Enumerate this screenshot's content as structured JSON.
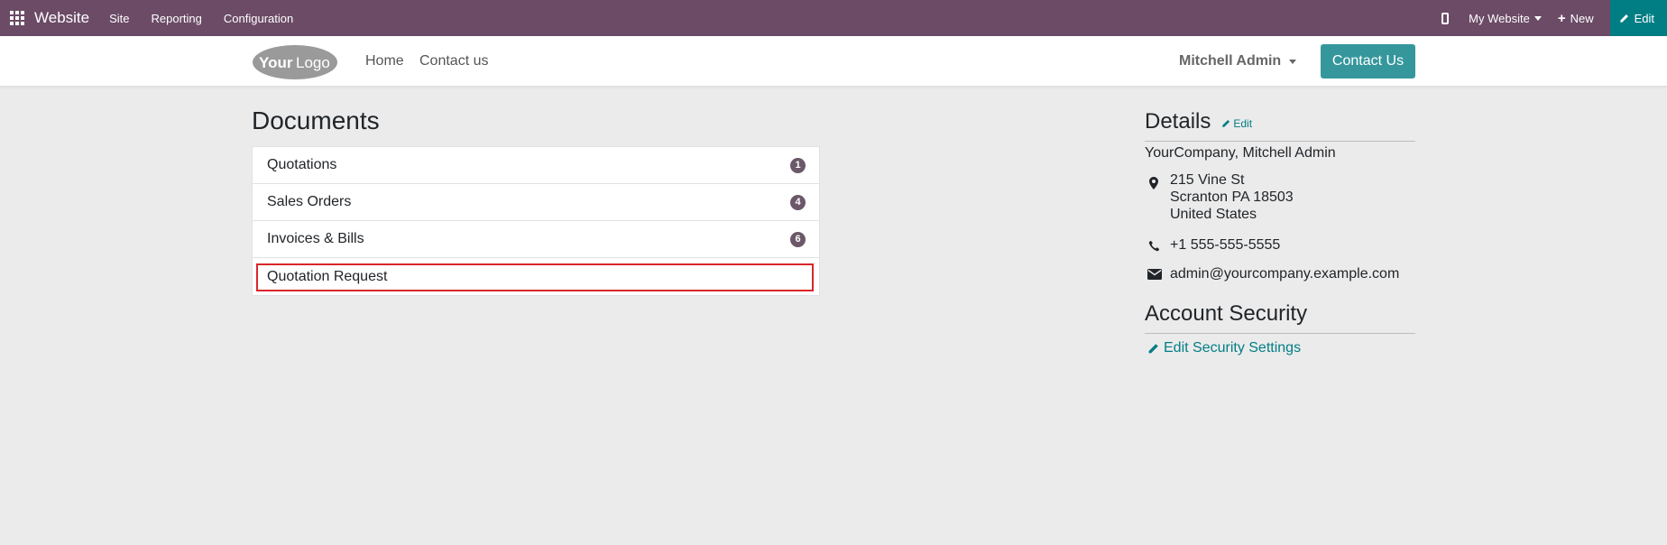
{
  "topbar": {
    "brand": "Website",
    "menus": [
      "Site",
      "Reporting",
      "Configuration"
    ],
    "website_selector": "My Website",
    "new_label": "New",
    "edit_label": "Edit"
  },
  "header": {
    "logo_text": "YourLogo",
    "nav": [
      "Home",
      "Contact us"
    ],
    "user": "Mitchell Admin",
    "contact_button": "Contact Us"
  },
  "documents": {
    "title": "Documents",
    "items": [
      {
        "label": "Quotations",
        "count": "1"
      },
      {
        "label": "Sales Orders",
        "count": "4"
      },
      {
        "label": "Invoices & Bills",
        "count": "6"
      },
      {
        "label": "Quotation Request",
        "count": ""
      }
    ]
  },
  "details": {
    "title": "Details",
    "edit_label": "Edit",
    "company": "YourCompany, Mitchell Admin",
    "address_lines": [
      "215 Vine St",
      "Scranton PA 18503",
      "United States"
    ],
    "phone": "+1 555-555-5555",
    "email": "admin@yourcompany.example.com"
  },
  "security": {
    "title": "Account Security",
    "link": "Edit Security Settings"
  },
  "colors": {
    "topbar": "#6b4b66",
    "accent": "#017e84",
    "button": "#35979c",
    "highlight": "#d9262b"
  }
}
